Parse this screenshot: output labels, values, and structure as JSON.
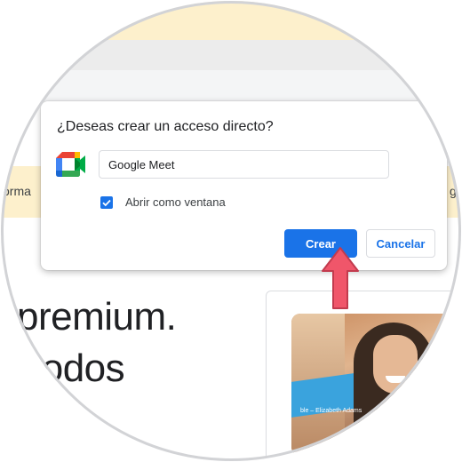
{
  "background": {
    "banner_left_text": "orma",
    "banner_right_text": "g",
    "headline_line1": "premium.",
    "headline_line2": "todos",
    "video_caption": "ble – Elizabeth Adams"
  },
  "dialog": {
    "title": "¿Deseas crear un acceso directo?",
    "app_icon": "google-meet-icon",
    "name_value": "Google Meet",
    "open_as_window_label": "Abrir como ventana",
    "open_as_window_checked": true,
    "create_label": "Crear",
    "cancel_label": "Cancelar"
  },
  "colors": {
    "accent": "#1a73e8",
    "banner": "#fdf0cc",
    "arrow": "#f0566a"
  }
}
